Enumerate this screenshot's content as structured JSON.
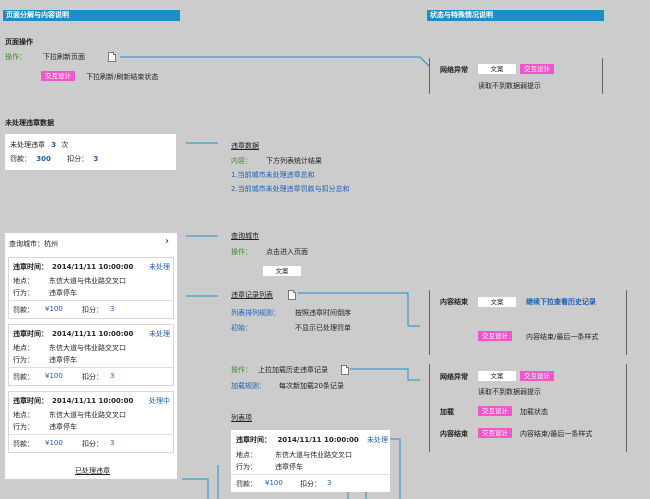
{
  "headers": {
    "left": "页面分解与内容说明",
    "right": "状态与特殊情况说明"
  },
  "page_ops": {
    "title": "页面操作",
    "op_label": "操作：",
    "op_text": "下拉刷新页面",
    "tag": "交互设计",
    "tag_text": "下拉刷新/刷新结束状态"
  },
  "network_error": {
    "label": "网络异常",
    "btn": "文案",
    "tag": "交互设计",
    "desc": "读取不到数据弱提示"
  },
  "unhandled": {
    "title": "未处理违章数据",
    "count_prefix": "未处理违章",
    "count": "3",
    "count_unit": "次",
    "fine_label": "罚款：",
    "fine": "300",
    "points_label": "扣分：",
    "points": "3"
  },
  "violation_data": {
    "title": "违章数据",
    "content_label": "内容：",
    "content_text": "下方列表统计结果",
    "line1": "1.当前城市未处理违章总和",
    "line2": "2.当前城市未处理违章罚款与扣分总和"
  },
  "city_query": {
    "title": "查询城市",
    "op_label": "操作：",
    "op_text": "点击进入页面",
    "btn": "文案"
  },
  "phone": {
    "city_label": "查询城市：杭州",
    "chevron": "›",
    "footer_link": "已处理违章",
    "records": [
      {
        "time_label": "违章时间：",
        "time": "2014/11/11  10:00:00",
        "status": "未处理",
        "place_label": "地点：",
        "place": "东信大道与伟业路交叉口",
        "action_label": "行为：",
        "action": "违章停车",
        "fine_label": "罚款：",
        "fine": "¥100",
        "points_label": "扣分：",
        "points": "3"
      },
      {
        "time_label": "违章时间：",
        "time": "2014/11/11  10:00:00",
        "status": "未处理",
        "place_label": "地点：",
        "place": "东信大道与伟业路交叉口",
        "action_label": "行为：",
        "action": "违章停车",
        "fine_label": "罚款：",
        "fine": "¥100",
        "points_label": "扣分：",
        "points": "3"
      },
      {
        "time_label": "违章时间：",
        "time": "2014/11/11  10:00:00",
        "status": "处理中",
        "place_label": "地点：",
        "place": "东信大道与伟业路交叉口",
        "action_label": "行为：",
        "action": "违章停车",
        "fine_label": "罚款：",
        "fine": "¥100",
        "points_label": "扣分：",
        "points": "3"
      }
    ]
  },
  "records_list": {
    "title": "违章记录列表",
    "rule_label": "列表排列规则：",
    "rule_text": "按照违章时间倒序",
    "init_label": "初始：",
    "init_text": "不显示已处理罚单"
  },
  "content_end": {
    "label": "内容结束",
    "btn": "文案",
    "link": "继续下拉查看历史记录",
    "tag": "交互设计",
    "desc": "内容结束/最后一条样式"
  },
  "load_more": {
    "op_label": "操作：",
    "op_text": "上拉加载历史违章记录",
    "rule_label": "加载规则：",
    "rule_text": "每次新加载20条记录"
  },
  "load_states": {
    "net_label": "网络异常",
    "net_btn": "文案",
    "net_tag": "交互设计",
    "net_desc": "读取不到数据弱提示",
    "load_label": "加载",
    "load_tag": "交互设计",
    "load_desc": "加载状态",
    "end_label": "内容结束",
    "end_tag": "交互设计",
    "end_desc": "内容结束/最后一条样式"
  },
  "list_item": {
    "title": "列表项",
    "time_label": "违章时间：",
    "time": "2014/11/11  10:00:00",
    "status": "未处理",
    "place_label": "地点：",
    "place": "东信大道与伟业路交叉口",
    "action_label": "行为：",
    "action": "违章停车",
    "fine_label": "罚款：",
    "fine": "¥100",
    "points_label": "扣分：",
    "points": "3"
  },
  "colors": {
    "header_blue": "#1b8fc5",
    "pink_tag": "#f057c8",
    "line_blue": "#1d8fc9",
    "green": "#3a8c2a",
    "link_blue": "#1d5fb0"
  }
}
